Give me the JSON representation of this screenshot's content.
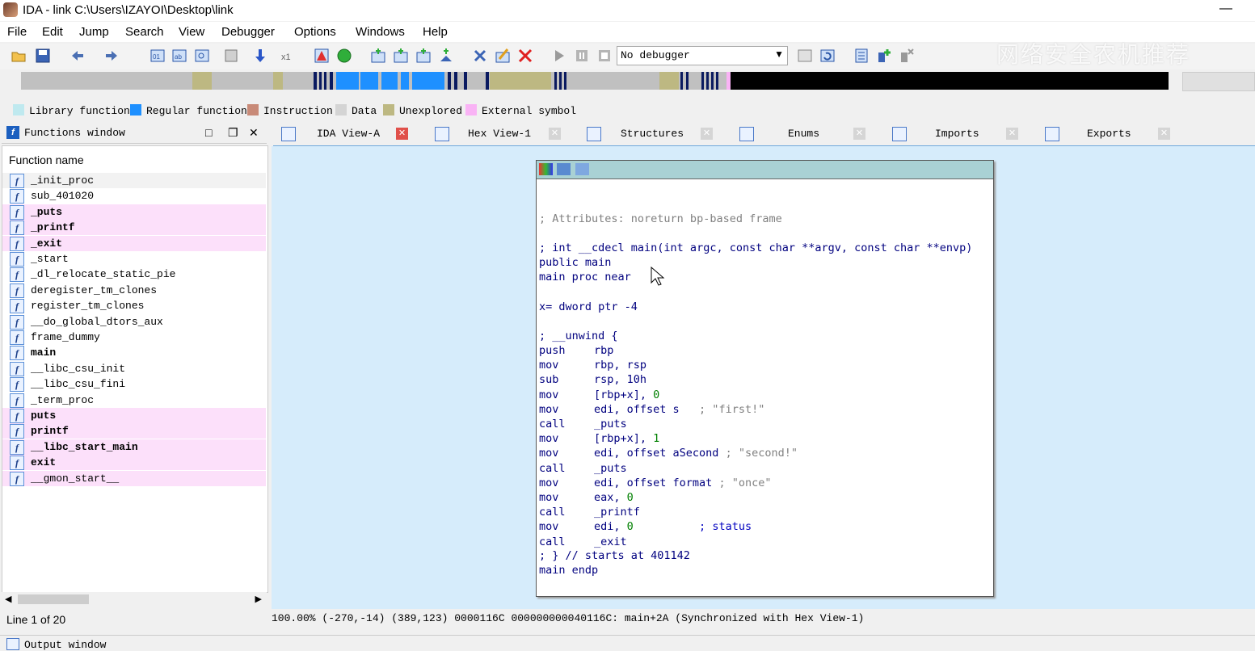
{
  "window": {
    "title": "IDA - link C:\\Users\\IZAYOI\\Desktop\\link",
    "minimize": "—"
  },
  "menu": [
    "File",
    "Edit",
    "Jump",
    "Search",
    "View",
    "Debugger",
    "Options",
    "Windows",
    "Help"
  ],
  "toolbar": {
    "debugger_select": "No debugger",
    "icons": [
      "open-icon",
      "save-icon",
      "back-icon",
      "forward-icon",
      "hex-icon",
      "text-icon",
      "search-icon",
      "graph-icon",
      "down-arrow-icon",
      "xref-icon",
      "warning-icon",
      "green-circle-icon",
      "run-icon",
      "stop-icon",
      "close-icon",
      "play-icon",
      "pause-icon",
      "stop-square-icon"
    ]
  },
  "watermark": "网络安全农机推荐",
  "legend": [
    {
      "label": "Library function",
      "color": "#bfe9ef"
    },
    {
      "label": "Regular function",
      "color": "#1e90ff"
    },
    {
      "label": "Instruction",
      "color": "#c88a78"
    },
    {
      "label": "Data",
      "color": "#d4d4d4"
    },
    {
      "label": "Unexplored",
      "color": "#bdb882"
    },
    {
      "label": "External symbol",
      "color": "#f9b3f5"
    }
  ],
  "functions_window": {
    "title": "Functions window",
    "column_header": "Function name",
    "items": [
      {
        "name": "_init_proc",
        "style": "normal"
      },
      {
        "name": "sub_401020",
        "style": "normal"
      },
      {
        "name": "_puts",
        "style": "lib"
      },
      {
        "name": "_printf",
        "style": "lib"
      },
      {
        "name": "_exit",
        "style": "lib"
      },
      {
        "name": "_start",
        "style": "normal"
      },
      {
        "name": "_dl_relocate_static_pie",
        "style": "normal"
      },
      {
        "name": "deregister_tm_clones",
        "style": "normal"
      },
      {
        "name": "register_tm_clones",
        "style": "normal"
      },
      {
        "name": "__do_global_dtors_aux",
        "style": "normal"
      },
      {
        "name": "frame_dummy",
        "style": "normal"
      },
      {
        "name": "main",
        "style": "bold"
      },
      {
        "name": "__libc_csu_init",
        "style": "normal"
      },
      {
        "name": "__libc_csu_fini",
        "style": "normal"
      },
      {
        "name": "_term_proc",
        "style": "normal"
      },
      {
        "name": "puts",
        "style": "lib"
      },
      {
        "name": "printf",
        "style": "lib"
      },
      {
        "name": "__libc_start_main",
        "style": "lib"
      },
      {
        "name": "exit",
        "style": "lib"
      },
      {
        "name": "__gmon_start__",
        "style": "lib-normal"
      }
    ],
    "line_count": "Line 1 of 20"
  },
  "tabs": [
    {
      "label": "IDA View-A",
      "active": true
    },
    {
      "label": "Hex View-1",
      "active": false
    },
    {
      "label": "Structures",
      "active": false
    },
    {
      "label": "Enums",
      "active": false
    },
    {
      "label": "Imports",
      "active": false
    },
    {
      "label": "Exports",
      "active": false
    }
  ],
  "disasm": {
    "attributes": "; Attributes: noreturn bp-based frame",
    "signature": "; int __cdecl main(int argc, const char **argv, const char **envp)",
    "public": "public main",
    "proc": "main proc near",
    "var": "x= dword ptr -4",
    "unwind": "; __unwind {",
    "lines": [
      {
        "mn": "push",
        "op": "rbp",
        "num": "",
        "cmt": ""
      },
      {
        "mn": "mov",
        "op": "rbp, rsp",
        "num": "",
        "cmt": ""
      },
      {
        "mn": "sub",
        "op": "rsp, 10h",
        "num": "",
        "cmt": ""
      },
      {
        "mn": "mov",
        "op": "[rbp+x], ",
        "num": "0",
        "cmt": ""
      },
      {
        "mn": "mov",
        "op": "edi, offset s",
        "num": "",
        "cmt": "   ; \"first!\""
      },
      {
        "mn": "call",
        "op": "_puts",
        "num": "",
        "cmt": ""
      },
      {
        "mn": "mov",
        "op": "[rbp+x], ",
        "num": "1",
        "cmt": ""
      },
      {
        "mn": "mov",
        "op": "edi, offset aSecond",
        "num": "",
        "cmt": " ; \"second!\""
      },
      {
        "mn": "call",
        "op": "_puts",
        "num": "",
        "cmt": ""
      },
      {
        "mn": "mov",
        "op": "edi, offset format",
        "num": "",
        "cmt": " ; \"once\""
      },
      {
        "mn": "mov",
        "op": "eax, ",
        "num": "0",
        "cmt": ""
      },
      {
        "mn": "call",
        "op": "_printf",
        "num": "",
        "cmt": ""
      },
      {
        "mn": "mov",
        "op": "edi, ",
        "num": "0",
        "cmt": "          ; status"
      },
      {
        "mn": "call",
        "op": "_exit",
        "num": "",
        "cmt": ""
      }
    ],
    "unwind_end": "; } // starts at 401142",
    "endp": "main endp"
  },
  "status_bar": "100.00% (-270,-14) (389,123) 0000116C 000000000040116C: main+2A (Synchronized with Hex View-1)",
  "output_window": "Output window"
}
